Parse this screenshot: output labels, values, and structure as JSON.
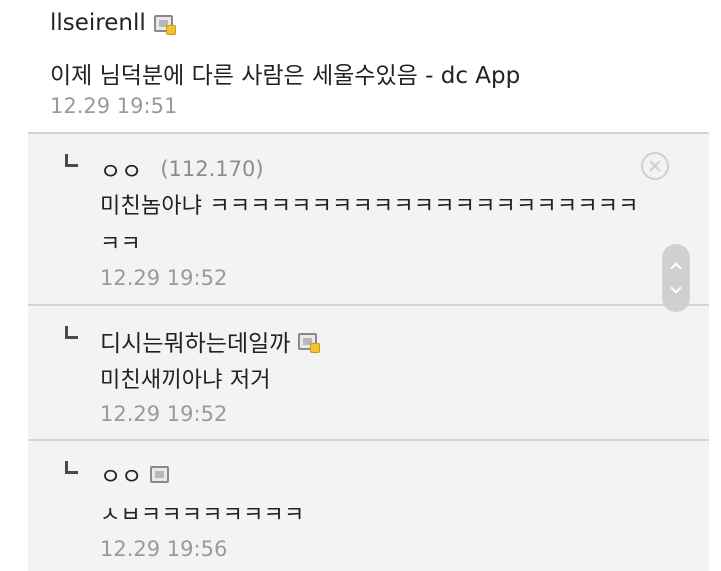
{
  "main_comment": {
    "nickname": "llseirenll",
    "body": "이제 님덕분에 다른 사람은 세울수있음 - dc App",
    "time": "12.29 19:51"
  },
  "replies": [
    {
      "nickname": "ㅇㅇ",
      "ip": "(112.170)",
      "body": "미친놈아냐 ㅋㅋㅋㅋㅋㅋㅋㅋㅋㅋㅋㅋㅋㅋㅋㅋㅋㅋㅋㅋㅋㅋㅋ",
      "time": "12.29 19:52"
    },
    {
      "nickname": "디시는뭐하는데일까",
      "body": "미친새끼아냐 저거",
      "time": "12.29 19:52"
    },
    {
      "nickname": "ㅇㅇ",
      "body": "ㅅㅂㅋㅋㅋㅋㅋㅋㅋㅋ",
      "time": "12.29 19:56"
    }
  ],
  "icons": {
    "fixed_nick": "gallog-fixed-icon",
    "half_fixed_nick": "gallog-icon",
    "delete": "delete-icon",
    "reply_arrow": "reply-arrow-icon",
    "scroll_up": "chevron-up-icon",
    "scroll_down": "chevron-down-icon"
  },
  "colors": {
    "reply_background": "#f3f3f3",
    "timestamp": "#9a9a9a",
    "text": "#222222"
  }
}
